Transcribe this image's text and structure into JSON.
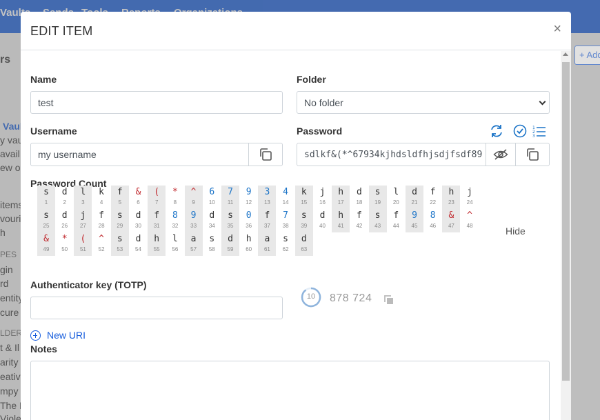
{
  "background": {
    "topnav": [
      "Vaults",
      "Sends",
      "Tools",
      "Reports",
      "Organizations"
    ],
    "sidebar": [
      "rs",
      "Vault",
      "y vault",
      "avail",
      "ew or",
      "items",
      "vourites",
      "h",
      "PES",
      "gin",
      "rd",
      "entity",
      "cure",
      "LDER",
      "t & Il",
      "arity",
      "eative",
      "mpy",
      "The P",
      "Violet"
    ],
    "add_button": "+ Add item"
  },
  "modal": {
    "title": "EDIT ITEM",
    "close_label": "×"
  },
  "form": {
    "name_label": "Name",
    "name_value": "test",
    "folder_label": "Folder",
    "folder_value": "No folder",
    "username_label": "Username",
    "username_value": "my username",
    "password_label": "Password",
    "password_value": "sdlkf&(*^67934kjhdsldfhjsdjfsdf89",
    "password_count_label": "Password Count",
    "hide_label": "Hide",
    "totp_label": "Authenticator key (TOTP)",
    "totp_value": "",
    "totp_seconds": "10",
    "totp_code": "878  724",
    "new_uri_label": "New URI",
    "notes_label": "Notes",
    "notes_value": ""
  },
  "password_chars": [
    "s",
    "d",
    "l",
    "k",
    "f",
    "&",
    "(",
    "*",
    "^",
    "6",
    "7",
    "9",
    "3",
    "4",
    "k",
    "j",
    "h",
    "d",
    "s",
    "l",
    "d",
    "f",
    "h",
    "j",
    "s",
    "d",
    "j",
    "f",
    "s",
    "d",
    "f",
    "8",
    "9",
    "d",
    "s",
    "0",
    "f",
    "7",
    "s",
    "d",
    "h",
    "f",
    "s",
    "f",
    "9",
    "8",
    "&",
    "^",
    "&",
    "*",
    "(",
    "^",
    "s",
    "d",
    "h",
    "l",
    "a",
    "s",
    "d",
    "h",
    "a",
    "s",
    "d"
  ],
  "colors": {
    "brand": "#175ddc",
    "digit": "#1a73c7",
    "symbol": "#c0282d"
  }
}
